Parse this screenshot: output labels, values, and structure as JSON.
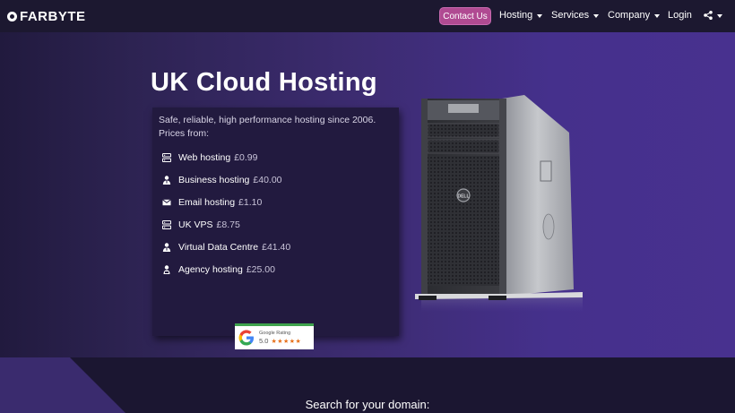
{
  "brand": {
    "name": "FARBYTE"
  },
  "nav": {
    "contact": "Contact Us",
    "items": [
      "Hosting",
      "Services",
      "Company",
      "Login"
    ]
  },
  "hero": {
    "title": "UK Cloud Hosting",
    "intro": "Safe, reliable, high performance hosting since 2006. Prices from:",
    "products": [
      {
        "name": "Web hosting",
        "price": "£0.99",
        "icon": "server-icon"
      },
      {
        "name": "Business hosting",
        "price": "£40.00",
        "icon": "business-user-icon"
      },
      {
        "name": "Email hosting",
        "price": "£1.10",
        "icon": "envelope-icon"
      },
      {
        "name": "UK VPS",
        "price": "£8.75",
        "icon": "server-icon"
      },
      {
        "name": "Virtual Data Centre",
        "price": "£41.40",
        "icon": "business-user-icon"
      },
      {
        "name": "Agency hosting",
        "price": "£25.00",
        "icon": "agency-user-icon"
      }
    ],
    "rating": {
      "label": "Google Rating",
      "score": "5.0",
      "stars": "★★★★★"
    }
  },
  "domain": {
    "heading": "Search for your domain:"
  },
  "colors": {
    "accent": "#b04a92",
    "hero": "#48318f",
    "dark": "#1b1631"
  }
}
